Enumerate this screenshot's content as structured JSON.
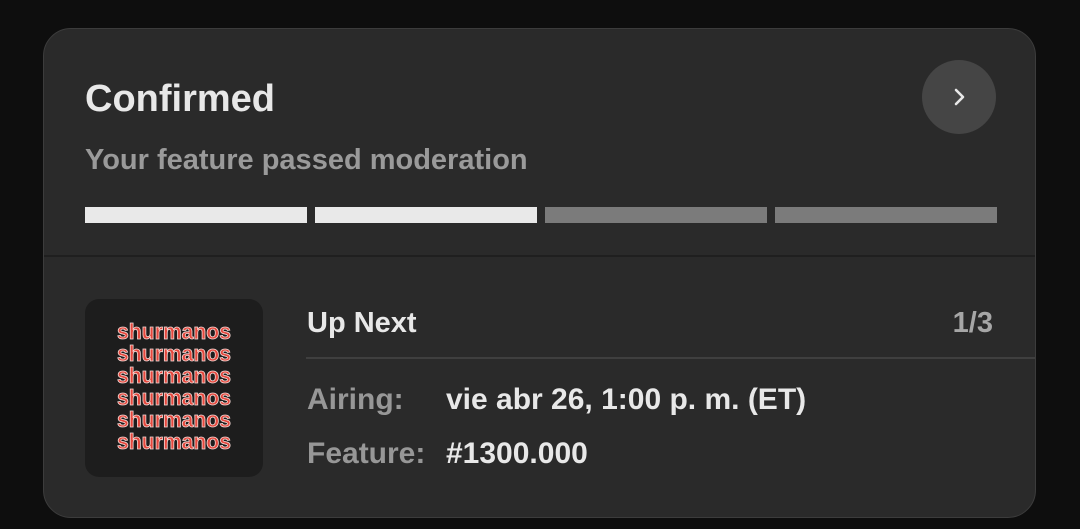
{
  "status": {
    "title": "Confirmed",
    "subtitle": "Your feature passed moderation",
    "progress": {
      "completed_steps": 2,
      "total_steps": 4
    }
  },
  "up_next": {
    "heading": "Up Next",
    "counter": "1/3",
    "thumbnail_text": "shurmanos",
    "airing_label": "Airing:",
    "airing_value": "vie abr 26, 1:00 p. m. (ET)",
    "feature_label": "Feature:",
    "feature_value": "#1300.000"
  },
  "colors": {
    "thumbnail_text": "#e5483d",
    "thumbnail_outline": "#f4d9d6",
    "progress_done": "#e9e9e9",
    "progress_pending": "#7b7b7b"
  }
}
